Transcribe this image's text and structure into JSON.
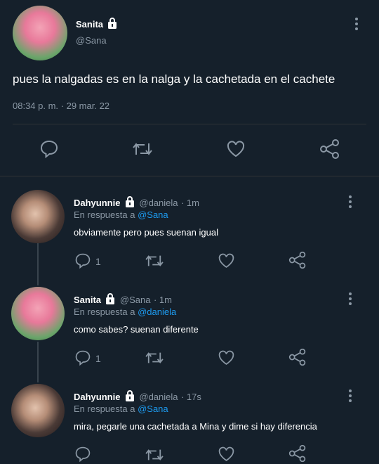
{
  "main_tweet": {
    "author_name": "Sanita",
    "author_handle": "@Sana",
    "text": "pues la nalgadas es en la nalga y la cachetada en el cachete",
    "time": "08:34 p. m.",
    "date": "· 29 mar. 22"
  },
  "replies": [
    {
      "author_name": "Dahyunnie",
      "author_handle": "@daniela",
      "age": "· 1m",
      "reply_prefix": "En respuesta a",
      "reply_to": "@Sana",
      "text": "obviamente pero pues suenan igual",
      "reply_count": "1"
    },
    {
      "author_name": "Sanita",
      "author_handle": "@Sana",
      "age": "· 1m",
      "reply_prefix": "En respuesta a",
      "reply_to": "@daniela",
      "text": "como sabes? suenan diferente",
      "reply_count": "1"
    },
    {
      "author_name": "Dahyunnie",
      "author_handle": "@daniela",
      "age": "· 17s",
      "reply_prefix": "En respuesta a",
      "reply_to": "@Sana",
      "text": "mira, pegarle una cachetada a Mina y dime si hay diferencia",
      "reply_count": ""
    }
  ],
  "colors": {
    "background": "#15202b",
    "link": "#1d9bf0",
    "muted": "#8b98a5",
    "divider": "#2f3336"
  },
  "icons": [
    "lock-icon",
    "more-icon",
    "reply-icon",
    "retweet-icon",
    "like-icon",
    "share-icon"
  ]
}
